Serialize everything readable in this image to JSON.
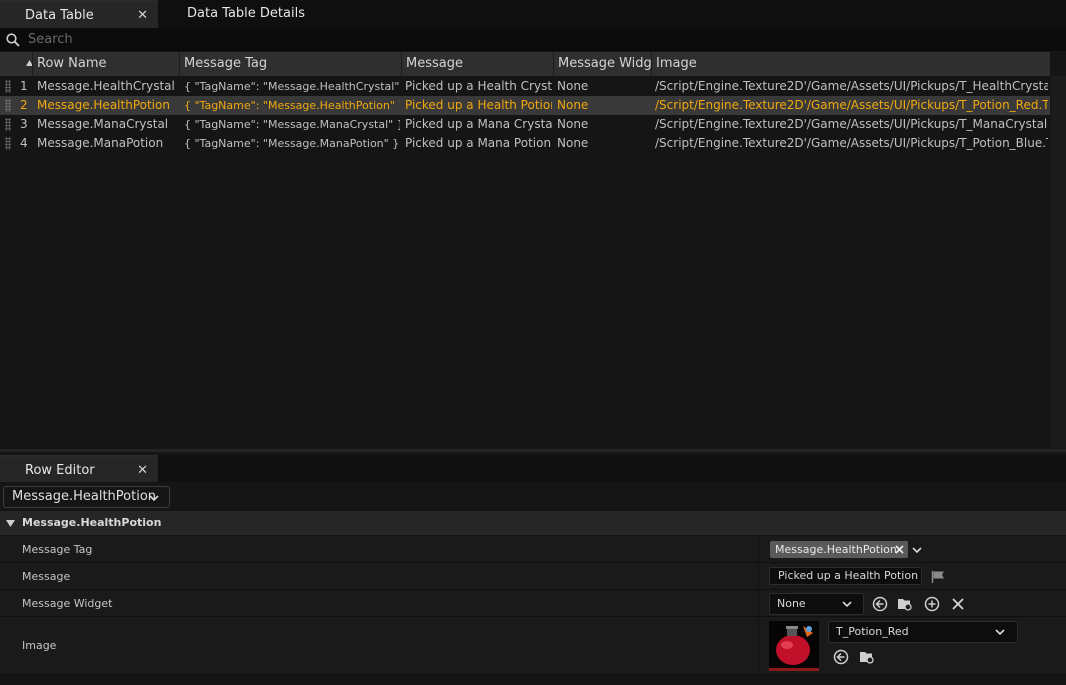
{
  "tabs": {
    "data_table": "Data Table",
    "data_table_details": "Data Table Details",
    "row_editor": "Row Editor",
    "close_glyph": "✕"
  },
  "search": {
    "placeholder": "Search"
  },
  "table": {
    "columns": [
      "Row Name",
      "Message Tag",
      "Message",
      "Message Widget",
      "Image"
    ],
    "rows": [
      {
        "index": "1",
        "row_name": "Message.HealthCrystal",
        "message_tag": "{ \"TagName\": \"Message.HealthCrystal\" }",
        "message": "Picked up a Health Crystal",
        "widget": "None",
        "image": "/Script/Engine.Texture2D'/Game/Assets/UI/Pickups/T_HealthCrystal.T_H"
      },
      {
        "index": "2",
        "row_name": "Message.HealthPotion",
        "message_tag": "{ \"TagName\": \"Message.HealthPotion\" }",
        "message": "Picked up a Health Potion",
        "widget": "None",
        "image": "/Script/Engine.Texture2D'/Game/Assets/UI/Pickups/T_Potion_Red.T_Pot"
      },
      {
        "index": "3",
        "row_name": "Message.ManaCrystal",
        "message_tag": "{ \"TagName\": \"Message.ManaCrystal\" }",
        "message": "Picked up a Mana Crystal",
        "widget": "None",
        "image": "/Script/Engine.Texture2D'/Game/Assets/UI/Pickups/T_ManaCrystal.T_M"
      },
      {
        "index": "4",
        "row_name": "Message.ManaPotion",
        "message_tag": "{ \"TagName\": \"Message.ManaPotion\" }",
        "message": "Picked up a Mana Potion",
        "widget": "None",
        "image": "/Script/Engine.Texture2D'/Game/Assets/UI/Pickups/T_Potion_Blue.T_Po"
      }
    ],
    "selected_row": 1
  },
  "row_editor": {
    "selected_row": "Message.HealthPotion",
    "category": "Message.HealthPotion",
    "properties": {
      "message_tag": {
        "label": "Message Tag",
        "value": "Message.HealthPotion"
      },
      "message": {
        "label": "Message",
        "value": "Picked up a Health Potion"
      },
      "message_widget": {
        "label": "Message Widget",
        "value": "None"
      },
      "image": {
        "label": "Image",
        "value": "T_Potion_Red"
      }
    }
  },
  "colors": {
    "selected_text": "#f0a80c",
    "background": "#151515",
    "header": "#2f2f2f"
  },
  "icons": [
    "search-icon",
    "close-icon",
    "sort-ascending-icon",
    "row-drag-handle-icon",
    "chevron-down-icon",
    "expand-triangle-icon",
    "flag-icon",
    "browse-to-asset-icon",
    "use-selected-asset-icon",
    "add-icon",
    "clear-icon",
    "potion-thumbnail"
  ]
}
